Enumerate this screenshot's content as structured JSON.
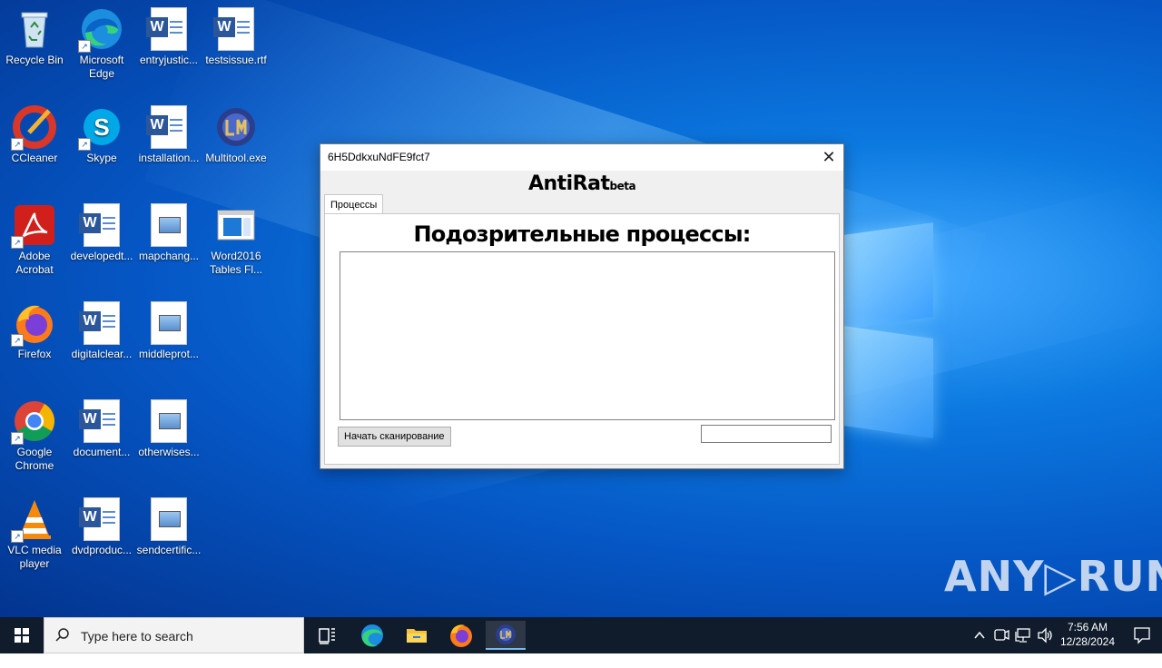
{
  "desktop": {
    "icons": [
      {
        "label": "Recycle Bin"
      },
      {
        "label": "Microsoft Edge"
      },
      {
        "label": "entryjustic..."
      },
      {
        "label": "testsissue.rtf"
      },
      {
        "label": "CCleaner"
      },
      {
        "label": "Skype"
      },
      {
        "label": "installation..."
      },
      {
        "label": "Multitool.exe"
      },
      {
        "label": "Adobe Acrobat"
      },
      {
        "label": "developedt..."
      },
      {
        "label": "mapchang..."
      },
      {
        "label": "Word2016 Tables Fl..."
      },
      {
        "label": "Firefox"
      },
      {
        "label": "digitalclear..."
      },
      {
        "label": "middleprot..."
      },
      {
        "label": "Google Chrome"
      },
      {
        "label": "document..."
      },
      {
        "label": "otherwises..."
      },
      {
        "label": "VLC media player"
      },
      {
        "label": "dvdproduc..."
      },
      {
        "label": "sendcertific..."
      }
    ]
  },
  "window": {
    "title": "6H5DdkxuNdFE9fct7",
    "close_glyph": "✕",
    "app_name": "AntiRat",
    "app_suffix": "beta",
    "tab_label": "Процессы",
    "heading": "Подозрительные процессы:",
    "scan_button": "Начать сканирование",
    "status_value": ""
  },
  "watermark": "ANY▷RUN",
  "taskbar": {
    "search_placeholder": "Type here to search",
    "time": "7:56 AM",
    "date": "12/28/2024"
  },
  "colors": {
    "accent": "#0c79e0",
    "taskbar": "#101c2c",
    "word_blue": "#2b579a"
  }
}
